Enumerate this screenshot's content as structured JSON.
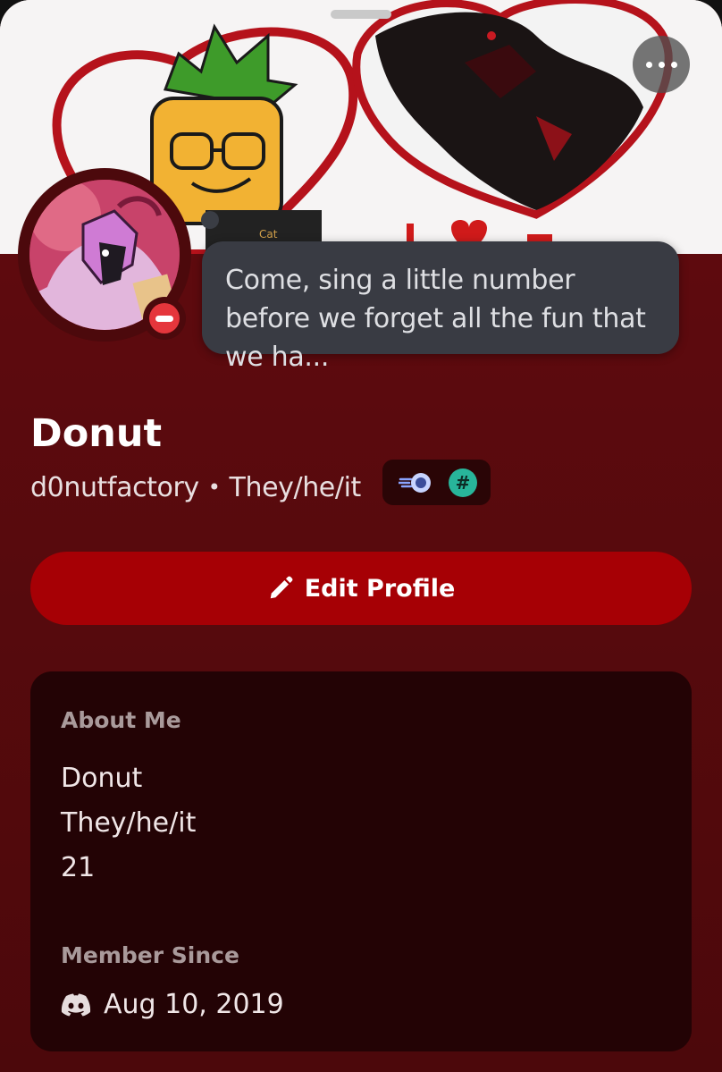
{
  "profile": {
    "display_name": "Donut",
    "username": "d0nutfactory",
    "separator": "•",
    "pronouns": "They/he/it",
    "custom_status": "Come, sing a little number before we forget all the fun that we ha...",
    "status_indicator": "do-not-disturb"
  },
  "actions": {
    "edit_profile_label": "Edit Profile",
    "more_label": "..."
  },
  "about": {
    "title": "About Me",
    "lines": [
      "Donut",
      "They/he/it",
      "21"
    ]
  },
  "member_since": {
    "title": "Member Since",
    "date": "Aug 10, 2019"
  },
  "badges": {
    "hash_symbol": "#"
  },
  "colors": {
    "theme_primary": "#5a0a0d",
    "button": "#a60005",
    "card": "#230305",
    "dnd": "#e5363c",
    "hash_badge": "#28b59a"
  }
}
